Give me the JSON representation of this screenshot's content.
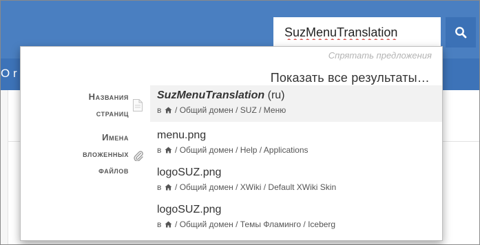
{
  "search": {
    "value": "SuzMenuTranslation"
  },
  "subbar": {
    "partial_text": "O r"
  },
  "dropdown": {
    "hide_suggestions": "Спрятать предложения",
    "show_all_results": "Показать все результаты…",
    "categories": [
      {
        "line1": "Названия",
        "line2": "страниц",
        "icon": "document-icon"
      },
      {
        "line1": "Имена",
        "line2": "вложенных",
        "line3": "файлов",
        "icon": "paperclip-icon"
      }
    ],
    "results": [
      {
        "title": "SuzMenuTranslation",
        "lang": " (ru)",
        "prefix": "в",
        "path": " / Общий домен / SUZ / Меню",
        "active": true
      },
      {
        "title": "menu.png",
        "prefix": "в",
        "path": " / Общий домен / Help / Applications"
      },
      {
        "title": "logoSUZ.png",
        "prefix": "в",
        "path": " / Общий домен / XWiki / Default XWiki Skin"
      },
      {
        "title": "logoSUZ.png",
        "prefix": "в",
        "path": " / Общий домен / Темы Фламинго / Iceberg"
      }
    ]
  },
  "colors": {
    "header": "#4a7fc1",
    "subbar": "#3d73b8",
    "search_button": "#3b71b6"
  }
}
